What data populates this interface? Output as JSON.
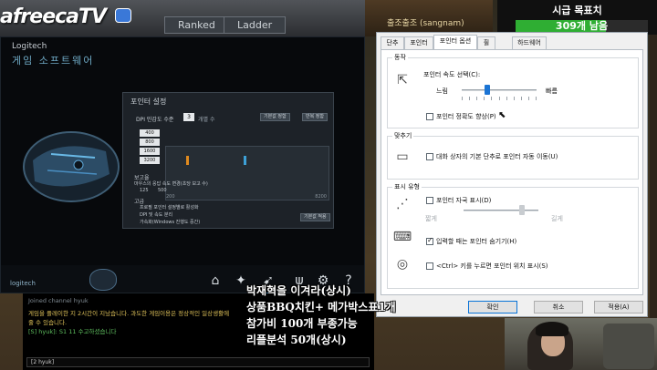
{
  "stream": {
    "logo_text": "afreecaTV",
    "goal_title": "시급 목표치",
    "goal_value": "309개 남음",
    "goal_progress": 0.68
  },
  "game": {
    "tabs": [
      "Ranked",
      "Ladder"
    ],
    "right_label": "출조출조 (sangnam)"
  },
  "logitech": {
    "brand": "Logitech",
    "title": "게임 소프트웨어",
    "panel_title": "포인터 설정",
    "dpi_label": "DPI 민감도 수준",
    "dpi_value": "3",
    "dpi_unit": "개별 수",
    "btn_default": "기본값 정함",
    "btn_shift": "반복 정함",
    "levels": [
      "400",
      "800",
      "1600",
      "3200"
    ],
    "graph_min": "200",
    "graph_max": "8200",
    "report_rate_label": "보고율",
    "report_rate_desc": "마우스의 응답 속도 변경(초당 보고 수)",
    "report_rate_options": [
      "125",
      "500"
    ],
    "advanced_label": "고급",
    "advanced_options": [
      "프로필 포인터 설정별로 활성화",
      "DPI 및 속도 분리",
      "가속화(Windows 진행도 중간)"
    ],
    "apply_button": "기본값 적용",
    "footer_logo": "logitech",
    "nav_icons": [
      "home-icon",
      "sparkle-icon",
      "pointer-settings-icon",
      "claw-icon",
      "gear-icon",
      "help-icon"
    ]
  },
  "dialog": {
    "tabs": [
      "단추",
      "포인터",
      "포인터 옵션",
      "휠",
      "하드웨어"
    ],
    "active_tab": "포인터 옵션",
    "motion": {
      "group_title": "동작",
      "speed_label": "포인터 속도 선택(C):",
      "slow": "느림",
      "fast": "빠름",
      "speed_level": 0.34,
      "precision_label": "포인터 정확도 향상(P)",
      "precision_checked": false
    },
    "snap": {
      "group_title": "맞추기",
      "snap_label": "대화 상자의 기본 단추로 포인터 자동 이동(U)",
      "snap_checked": false
    },
    "visibility": {
      "group_title": "표시 유형",
      "trails_label": "포인터 자국 표시(D)",
      "trails_checked": false,
      "short": "짧게",
      "long": "길게",
      "trails_level": 0.78,
      "hide_label": "입력할 때는 포인터 숨기기(H)",
      "hide_checked": true,
      "ctrl_label": "<Ctrl> 키를 누르면 포인터 위치 표시(S)",
      "ctrl_checked": false
    },
    "buttons": {
      "ok": "확인",
      "cancel": "취소",
      "apply": "적용(A)"
    }
  },
  "chat": {
    "lines": [
      {
        "text": "Joined channel hyuk",
        "color": "#7f8a92"
      },
      {
        "text": "게임을 플레이한 지 2시간이 지났습니다. 과도한 게임이용은 정상적인 일상생활에",
        "color": "#e0c35a"
      },
      {
        "text": "줄 수 있습니다.",
        "color": "#e0c35a"
      },
      {
        "text": "[S] hyuk]: S1 11 수고하셨습니다",
        "color": "#5fbf5f"
      }
    ],
    "input_label": "[2 hyuk]"
  },
  "overlay": {
    "lines": [
      "박재혁을 이겨라(상시)",
      "상품BBQ치킨+ 메가박스표1개",
      "참가비 100개 부종가능",
      "리플분석 50개(상시)"
    ]
  }
}
